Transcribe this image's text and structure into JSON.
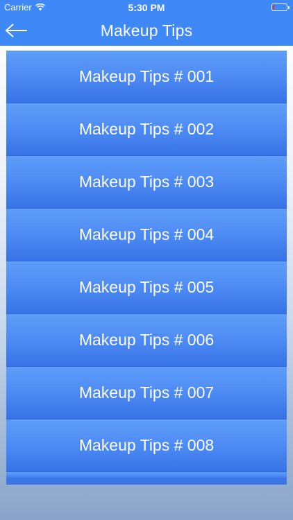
{
  "status_bar": {
    "carrier": "Carrier",
    "time": "5:30 PM",
    "battery_level": 0.1,
    "battery_low_color": "#e0332f"
  },
  "nav": {
    "title": "Makeup Tips",
    "back_icon": "arrow-left-icon",
    "background_color": "#3f88f7"
  },
  "list": {
    "items": [
      {
        "label": "Makeup Tips # 001"
      },
      {
        "label": "Makeup Tips # 002"
      },
      {
        "label": "Makeup Tips # 003"
      },
      {
        "label": "Makeup Tips # 004"
      },
      {
        "label": "Makeup Tips # 005"
      },
      {
        "label": "Makeup Tips # 006"
      },
      {
        "label": "Makeup Tips # 007"
      },
      {
        "label": "Makeup Tips # 008"
      }
    ]
  }
}
